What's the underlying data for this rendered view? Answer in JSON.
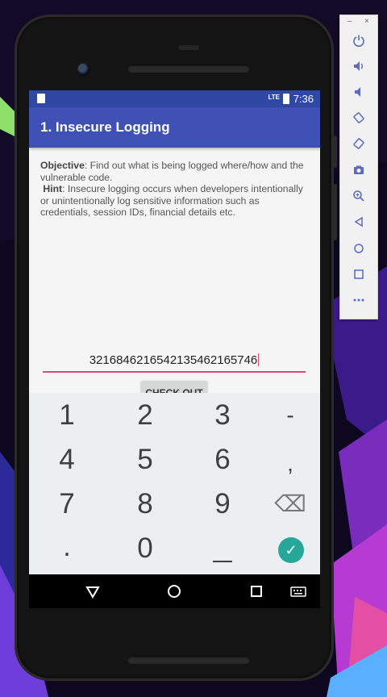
{
  "status_bar": {
    "time": "7:36",
    "network": "LTE"
  },
  "app_bar": {
    "title": "1. Insecure Logging"
  },
  "description": {
    "objective_label": "Objective",
    "objective_text": ": Find out what is being logged where/how and the vulnerable code.",
    "hint_label": "Hint",
    "hint_text": ": Insecure logging occurs when developers intentionally or unintentionally log sensitive information such as credentials, session IDs, financial details etc."
  },
  "input": {
    "value": "3216846216542135462165746"
  },
  "checkout_button": {
    "label": "CHECK OUT"
  },
  "keyboard": {
    "keys": [
      "1",
      "2",
      "3",
      "-",
      "4",
      "5",
      "6",
      ",",
      "7",
      "8",
      "9",
      "⌫",
      ".",
      "0",
      "_",
      "✓"
    ]
  },
  "emulator_toolbar": {
    "window_controls": [
      "–",
      "×"
    ],
    "icons": [
      "power-icon",
      "volume-up-icon",
      "volume-down-icon",
      "rotate-left-icon",
      "rotate-right-icon",
      "camera-icon",
      "zoom-icon",
      "back-icon",
      "home-icon",
      "overview-icon",
      "more-icon"
    ]
  },
  "colors": {
    "primary": "#3f51b5",
    "primary_dark": "#2f48a3",
    "accent": "#e0457b",
    "enter_key": "#27a79a"
  }
}
